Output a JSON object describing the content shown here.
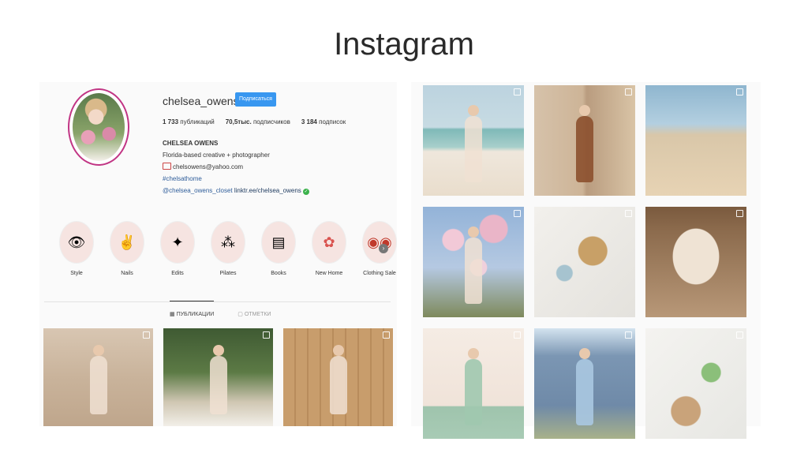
{
  "slide": {
    "title": "Instagram"
  },
  "profile": {
    "username": "chelsea_owens",
    "follow_label": "Подписаться",
    "stats": {
      "posts_value": "1 733",
      "posts_label": "публикаций",
      "followers_value": "70,5тыс.",
      "followers_label": "подписчиков",
      "following_value": "3 184",
      "following_label": "подписок"
    },
    "bio": {
      "name": "CHELSEA OWENS",
      "description": "Florida-based creative + photographer",
      "email": "chelsowens@yahoo.com",
      "hashtag": "#chelsathome",
      "mention": "@chelsea_owens_closet",
      "link": "linktr.ee/chelsea_owens"
    }
  },
  "highlights": [
    {
      "label": "Style",
      "icon": "eye-icon"
    },
    {
      "label": "Nails",
      "icon": "peace-hand-icon"
    },
    {
      "label": "Edits",
      "icon": "wand-icon"
    },
    {
      "label": "Pilates",
      "icon": "sparkle-icon"
    },
    {
      "label": "Books",
      "icon": "book-icon"
    },
    {
      "label": "New Home",
      "icon": "flower-icon"
    },
    {
      "label": "Clothing Sale",
      "icon": "sunglasses-icon"
    }
  ],
  "tabs": {
    "posts": "ПУБЛИКАЦИИ",
    "tagged": "ОТМЕТКИ"
  },
  "colors": {
    "follow_button": "#3897f0",
    "avatar_ring": "#c13584",
    "verified": "#3bb24b"
  }
}
